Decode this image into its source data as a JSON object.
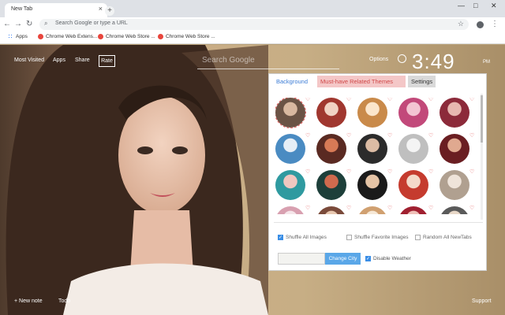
{
  "browser": {
    "tab_title": "New Tab",
    "tab_close": "×",
    "new_tab": "+",
    "win_min": "—",
    "win_max": "□",
    "win_close": "✕",
    "back": "←",
    "forward": "→",
    "reload": "↻",
    "omnibox_placeholder": "Search Google or type a URL",
    "star": "☆",
    "menu": "⋮"
  },
  "bookmarks": [
    {
      "label": "Apps"
    },
    {
      "label": "Chrome Web Extens..."
    },
    {
      "label": "Chrome Web Store ..."
    },
    {
      "label": "Chrome Web Store ..."
    }
  ],
  "topnav": {
    "most_visited": "Most Visited",
    "apps": "Apps",
    "share": "Share",
    "rate": "Rate"
  },
  "search": {
    "placeholder": "Search Google"
  },
  "options_label": "Options",
  "clock": {
    "time": "3:49",
    "ampm_top": "",
    "ampm_bottom": "PM"
  },
  "panel": {
    "tabs": [
      {
        "label": "Background"
      },
      {
        "label": "Must-have Related Themes"
      },
      {
        "label": "Settings"
      }
    ],
    "options": [
      {
        "label": "Shuffle All Images",
        "checked": true
      },
      {
        "label": "Shuffle Favorite Images",
        "checked": false
      },
      {
        "label": "Random All NewTabs",
        "checked": false
      }
    ],
    "change_city": "Change City",
    "disable_weather": "Disable Weather",
    "disable_weather_checked": true
  },
  "bottom": {
    "new_note": "+ New note",
    "todo": "Todo",
    "support": "Support"
  },
  "colors": {
    "accent": "#3a8ee6",
    "heart": "#e25555",
    "must_have_tab": "#f4c7c7"
  }
}
